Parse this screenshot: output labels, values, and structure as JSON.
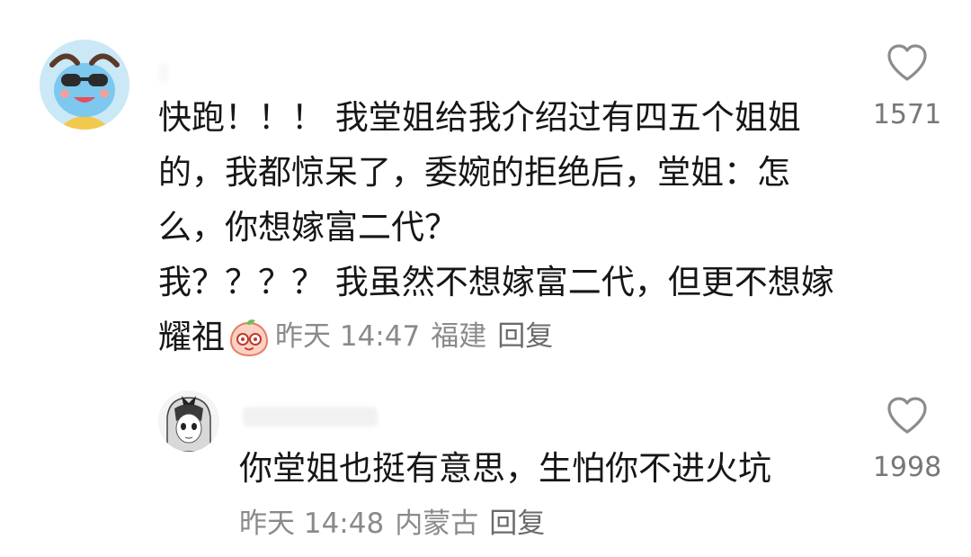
{
  "comment": {
    "lines": [
      "快跑！！！ 我堂姐给我介绍过有四五个姐姐",
      "的，我都惊呆了，委婉的拒绝后，堂姐：怎",
      "么，你想嫁富二代？",
      "我？？？？ 我虽然不想嫁富二代，但更不想嫁",
      "耀祖"
    ],
    "emoji_icon": "peach-face-emoji-icon",
    "time": "昨天 14:47",
    "location": "福建",
    "reply_label": "回复",
    "like_icon": "heart-icon",
    "likes": "1571"
  },
  "reply": {
    "text": "你堂姐也挺有意思，生怕你不进火坑",
    "time": "昨天 14:48",
    "location": "内蒙古",
    "reply_label": "回复",
    "like_icon": "heart-icon",
    "likes": "1998"
  },
  "colors": {
    "text_primary": "#161616",
    "text_meta": "#8a8a8a",
    "icon_stroke": "#8c8c8c"
  }
}
